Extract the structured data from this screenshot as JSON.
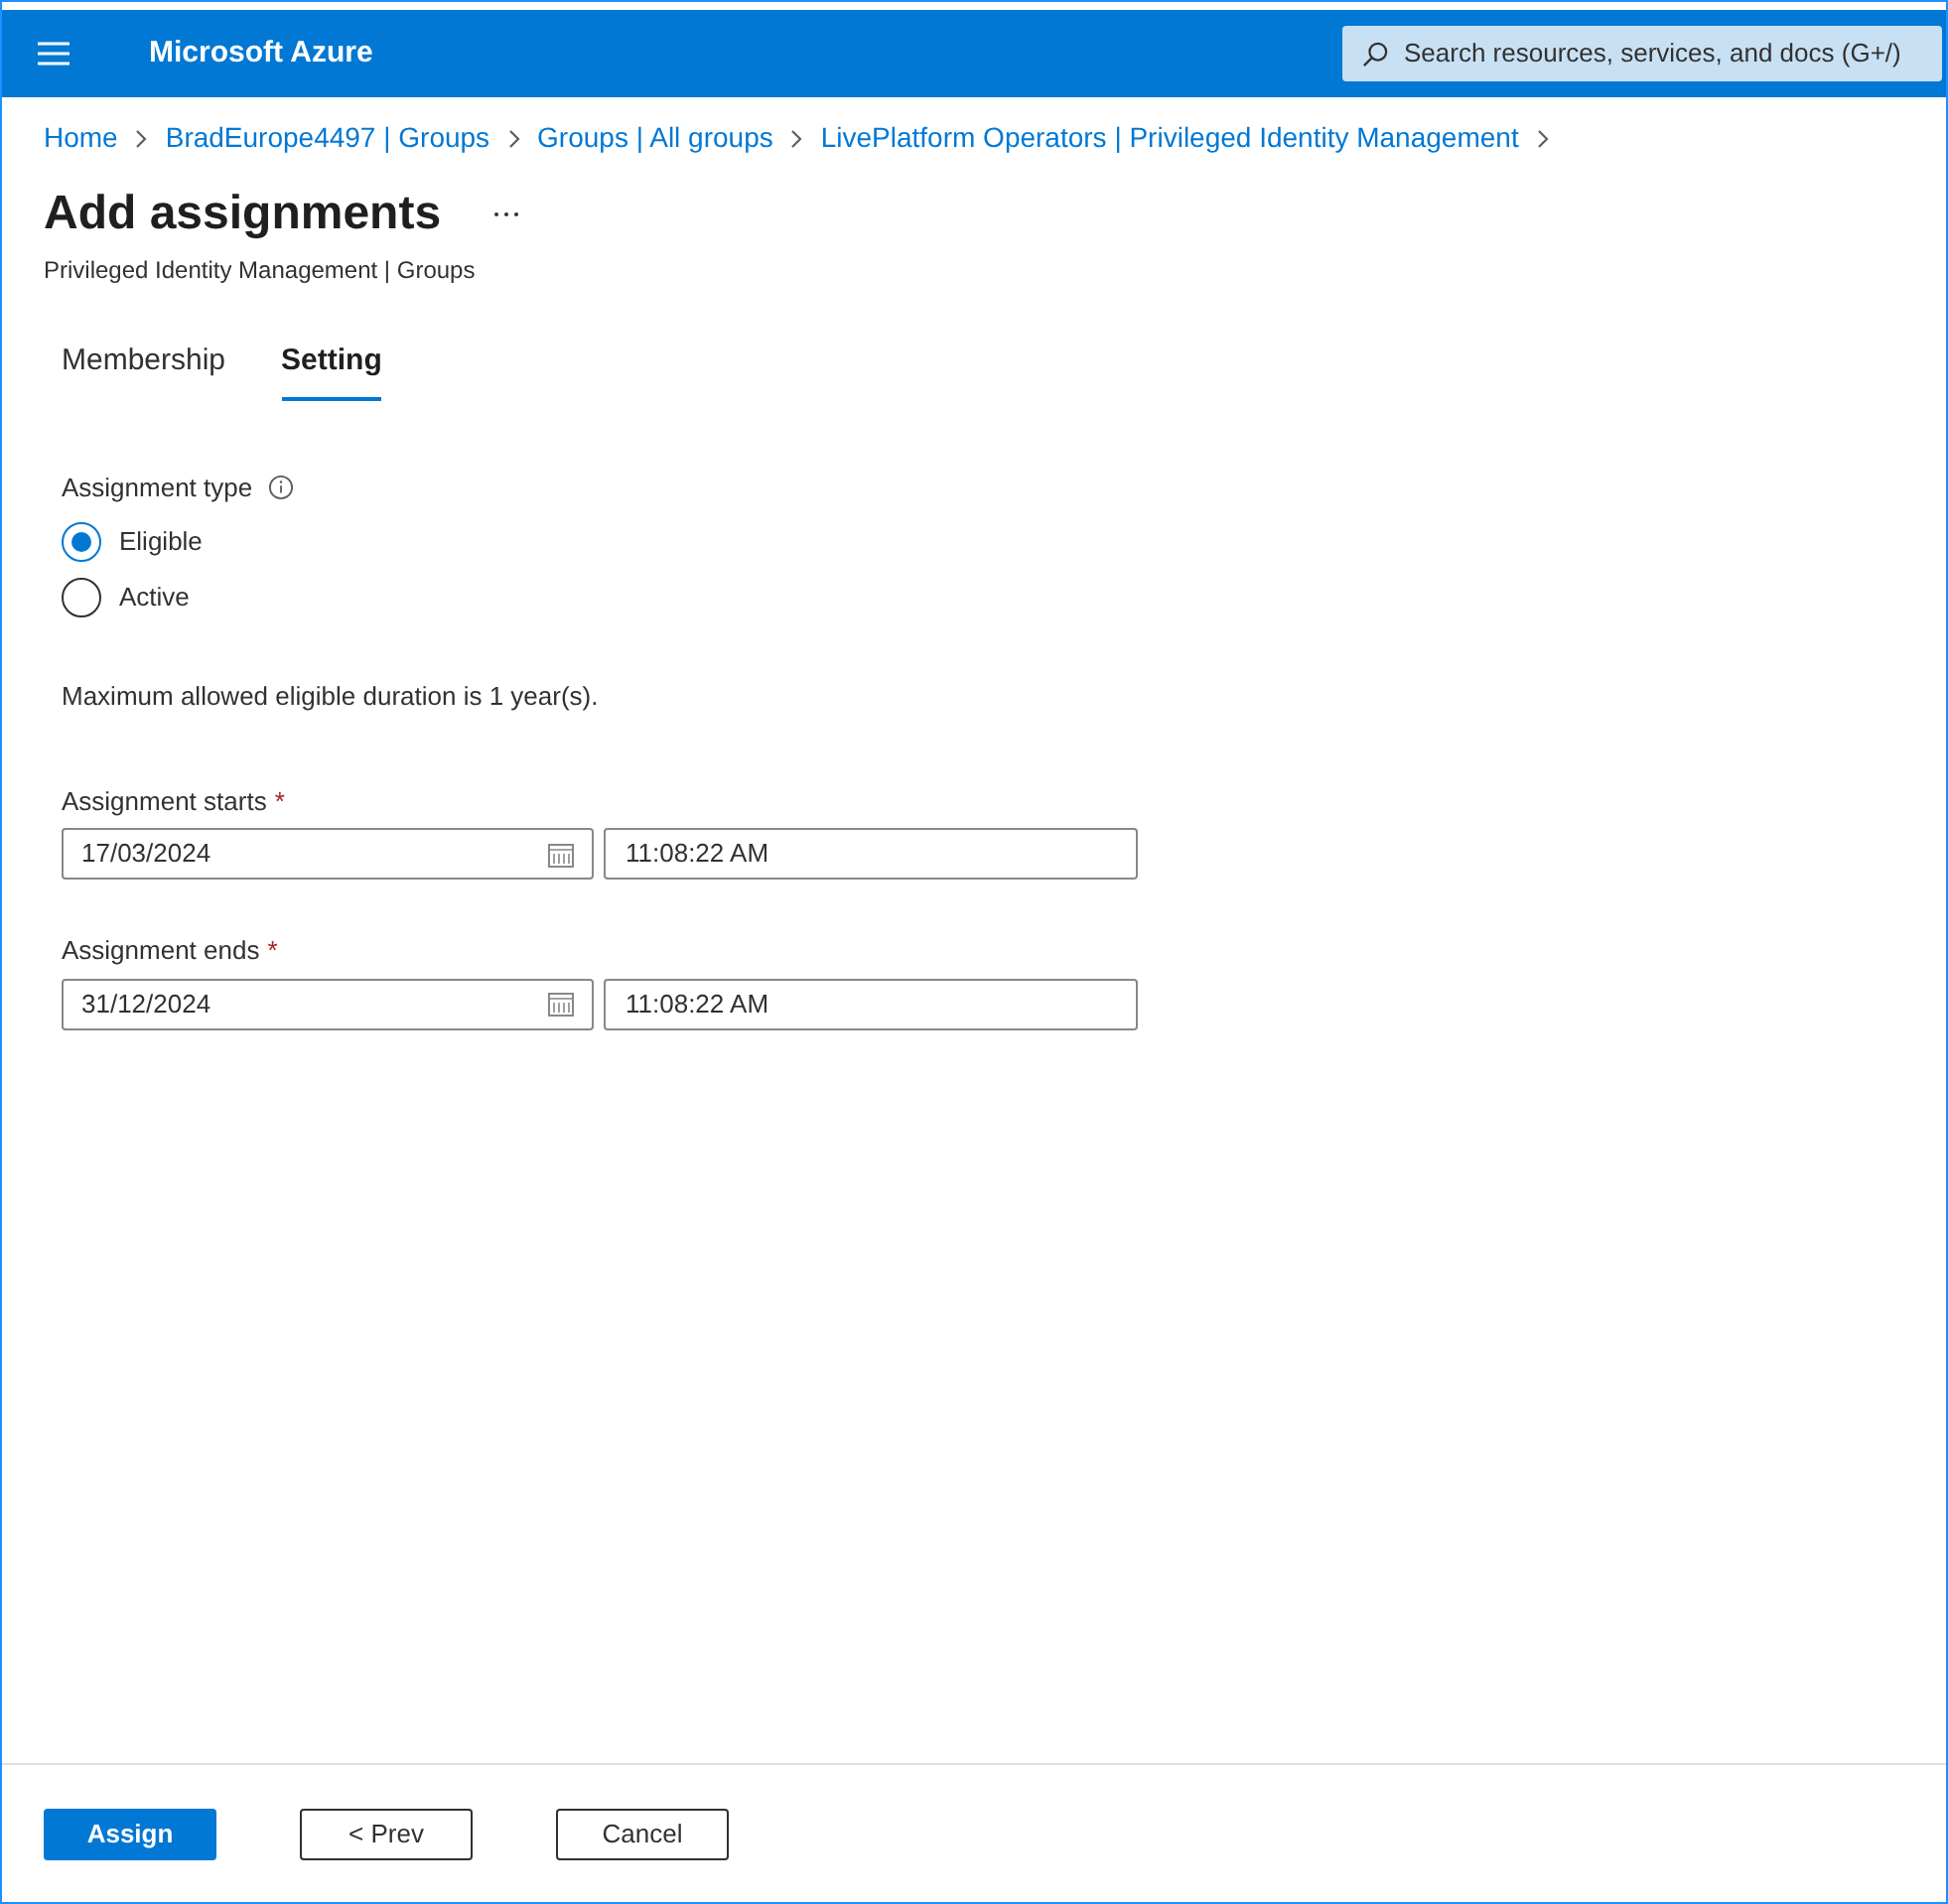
{
  "header": {
    "title": "Microsoft Azure",
    "search": {
      "placeholder": "Search resources, services, and docs (G+/)"
    }
  },
  "breadcrumb": [
    "Home",
    "BradEurope4497 | Groups",
    "Groups | All groups",
    "LivePlatform Operators | Privileged Identity Management"
  ],
  "page": {
    "title": "Add assignments",
    "subtitle": "Privileged Identity Management | Groups"
  },
  "tabs": [
    {
      "label": "Membership",
      "selected": false
    },
    {
      "label": "Setting",
      "selected": true
    }
  ],
  "assignment_type": {
    "label": "Assignment type",
    "options": [
      {
        "label": "Eligible",
        "selected": true
      },
      {
        "label": "Active",
        "selected": false
      }
    ]
  },
  "note": "Maximum allowed eligible duration is 1 year(s).",
  "fields": [
    {
      "label": "Assignment starts",
      "required_mark": "*",
      "date": "17/03/2024",
      "time": "11:08:22 AM"
    },
    {
      "label": "Assignment ends",
      "required_mark": "*",
      "date": "31/12/2024",
      "time": "11:08:22 AM"
    }
  ],
  "buttons": [
    {
      "label": "Assign",
      "kind": "primary"
    },
    {
      "label": "< Prev",
      "kind": "default"
    },
    {
      "label": "Cancel",
      "kind": "default"
    }
  ]
}
